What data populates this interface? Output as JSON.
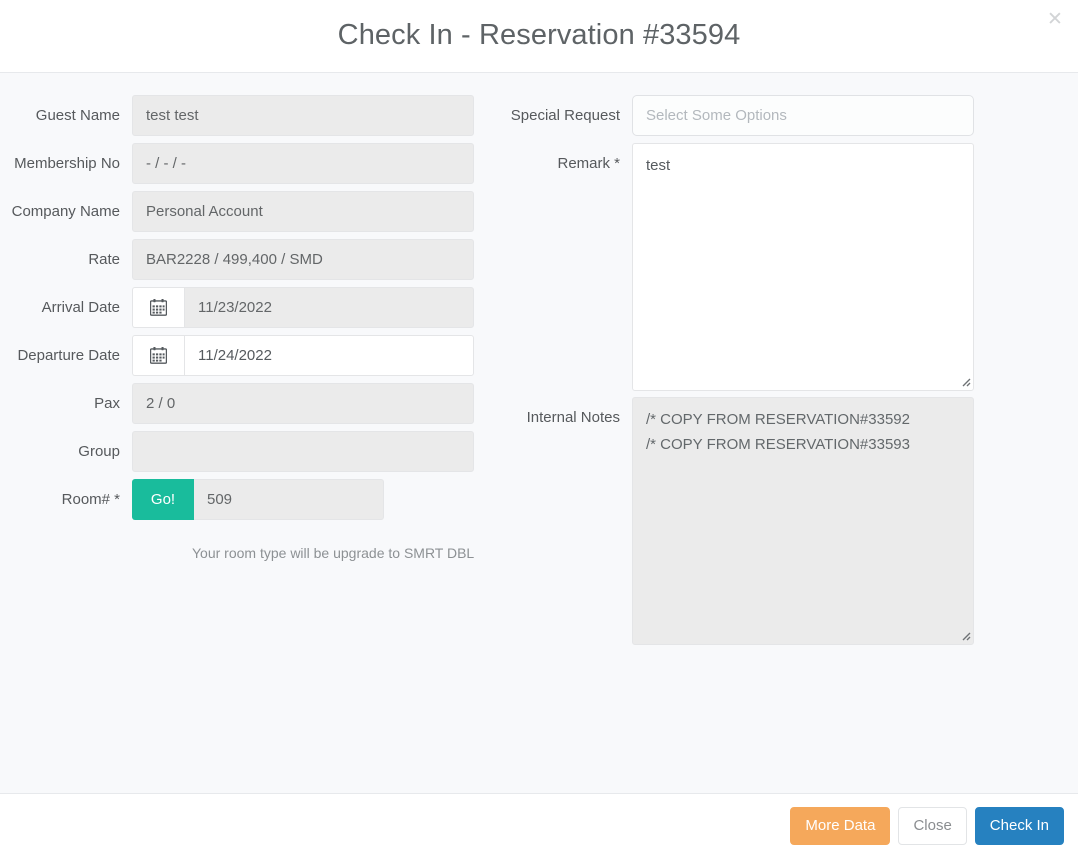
{
  "header": {
    "title": "Check In - Reservation #33594",
    "close_icon": "close-icon",
    "close_glyph": "✕"
  },
  "left_column": {
    "fields": [
      {
        "label": "Guest Name",
        "value": "test test",
        "type": "text",
        "disabled": true
      },
      {
        "label": "Membership No",
        "value": "- / - /  -",
        "type": "text",
        "disabled": true
      },
      {
        "label": "Company Name",
        "value": "Personal Account",
        "type": "text",
        "disabled": true
      },
      {
        "label": "Rate",
        "value": "BAR2228 / 499,400 / SMD",
        "type": "text",
        "disabled": true
      },
      {
        "label": "Arrival Date",
        "value": "11/23/2022",
        "type": "date",
        "disabled": true,
        "icon": "calendar-icon"
      },
      {
        "label": "Departure Date",
        "value": "11/24/2022",
        "type": "date",
        "disabled": false,
        "icon": "calendar-icon"
      },
      {
        "label": "Pax",
        "value": "2 / 0",
        "type": "text",
        "disabled": true
      },
      {
        "label": "Group",
        "value": "",
        "type": "text",
        "disabled": true
      },
      {
        "label": "Room# *",
        "value": "509",
        "type": "room",
        "disabled": true,
        "button_label": "Go!"
      }
    ],
    "upgrade_note": "Your room type will be upgrade to SMRT DBL"
  },
  "right_column": {
    "special_request": {
      "label": "Special Request",
      "placeholder": "Select Some Options",
      "value": ""
    },
    "remark": {
      "label": "Remark *",
      "value": "test",
      "disabled": false,
      "resize_handle": "resize-handle-icon"
    },
    "internal_notes": {
      "label": "Internal Notes",
      "value": "/* COPY FROM RESERVATION#33592\n/* COPY FROM RESERVATION#33593",
      "disabled": true,
      "resize_handle": "resize-handle-icon"
    }
  },
  "footer": {
    "more_data_label": "More Data",
    "close_label": "Close",
    "check_in_label": "Check In"
  },
  "colors": {
    "go_green": "#19bc9c",
    "more_data_orange": "#f5a85b",
    "check_in_blue": "#2681c0",
    "body_background": "#f8f9fb",
    "disabled_field": "#ebebeb",
    "label_text": "#56595c",
    "title_text": "#5e6366"
  }
}
